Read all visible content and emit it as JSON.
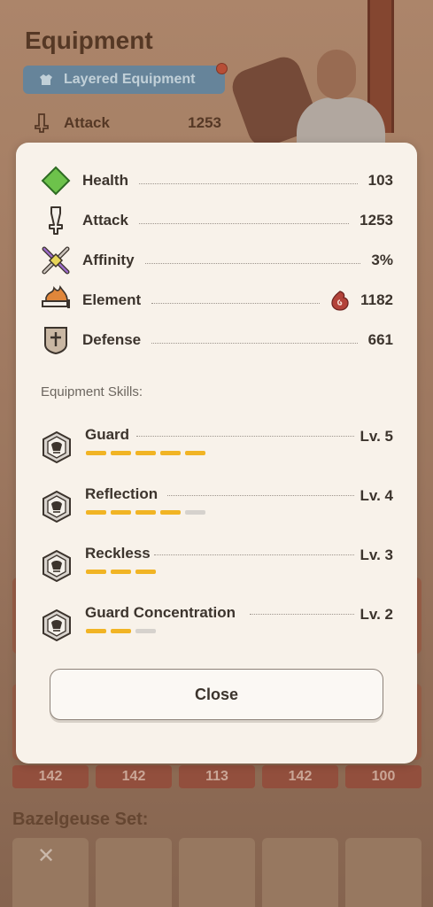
{
  "background": {
    "title": "Equipment",
    "layered_button_label": "Layered Equipment",
    "attack_label": "Attack",
    "attack_value": "1253",
    "slot_values": [
      "142",
      "142",
      "113",
      "142",
      "100"
    ],
    "set_label": "Bazelgeuse Set:"
  },
  "dialog": {
    "stats": [
      {
        "label": "Health",
        "value": "103",
        "icon": "health-diamond-icon"
      },
      {
        "label": "Attack",
        "value": "1253",
        "icon": "sword-icon"
      },
      {
        "label": "Affinity",
        "value": "3%",
        "icon": "affinity-crossed-blades-icon"
      },
      {
        "label": "Element",
        "value": "1182",
        "icon": "blazing-sword-icon",
        "element_icon": "blast-element-icon"
      },
      {
        "label": "Defense",
        "value": "661",
        "icon": "shield-icon"
      }
    ],
    "skills_heading": "Equipment Skills:",
    "skills": [
      {
        "name": "Guard",
        "level_label": "Lv. 5",
        "level": 5,
        "max_level": 5
      },
      {
        "name": "Reflection",
        "level_label": "Lv. 4",
        "level": 4,
        "max_level": 5
      },
      {
        "name": "Reckless",
        "level_label": "Lv. 3",
        "level": 3,
        "max_level": 3
      },
      {
        "name": "Guard Concentration",
        "level_label": "Lv. 2",
        "level": 2,
        "max_level": 3
      }
    ],
    "close_label": "Close"
  },
  "colors": {
    "dialog_bg": "#f8f2ea",
    "text": "#3c342d",
    "pip_active": "#f1b424",
    "pip_inactive": "#d6d2cd",
    "health_green": "#6dc24b",
    "element_red": "#b3433a"
  }
}
